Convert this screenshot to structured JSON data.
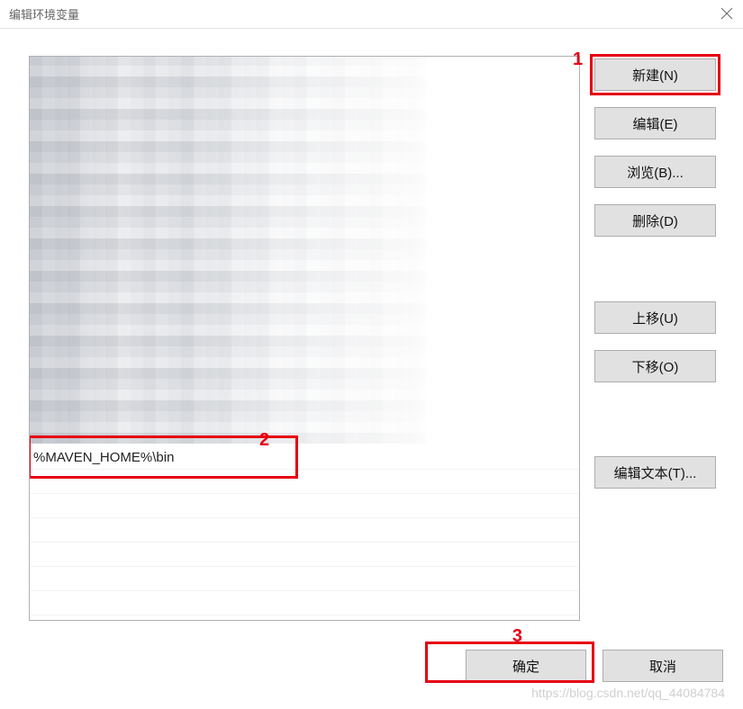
{
  "dialog": {
    "title": "编辑环境变量"
  },
  "list": {
    "entry_value": "%MAVEN_HOME%\\bin"
  },
  "buttons": {
    "new": "新建(N)",
    "edit": "编辑(E)",
    "browse": "浏览(B)...",
    "delete": "删除(D)",
    "move_up": "上移(U)",
    "move_down": "下移(O)",
    "edit_text": "编辑文本(T)...",
    "ok": "确定",
    "cancel": "取消"
  },
  "annotations": {
    "a1": "1",
    "a2": "2",
    "a3": "3"
  },
  "watermark": "https://blog.csdn.net/qq_44084784"
}
